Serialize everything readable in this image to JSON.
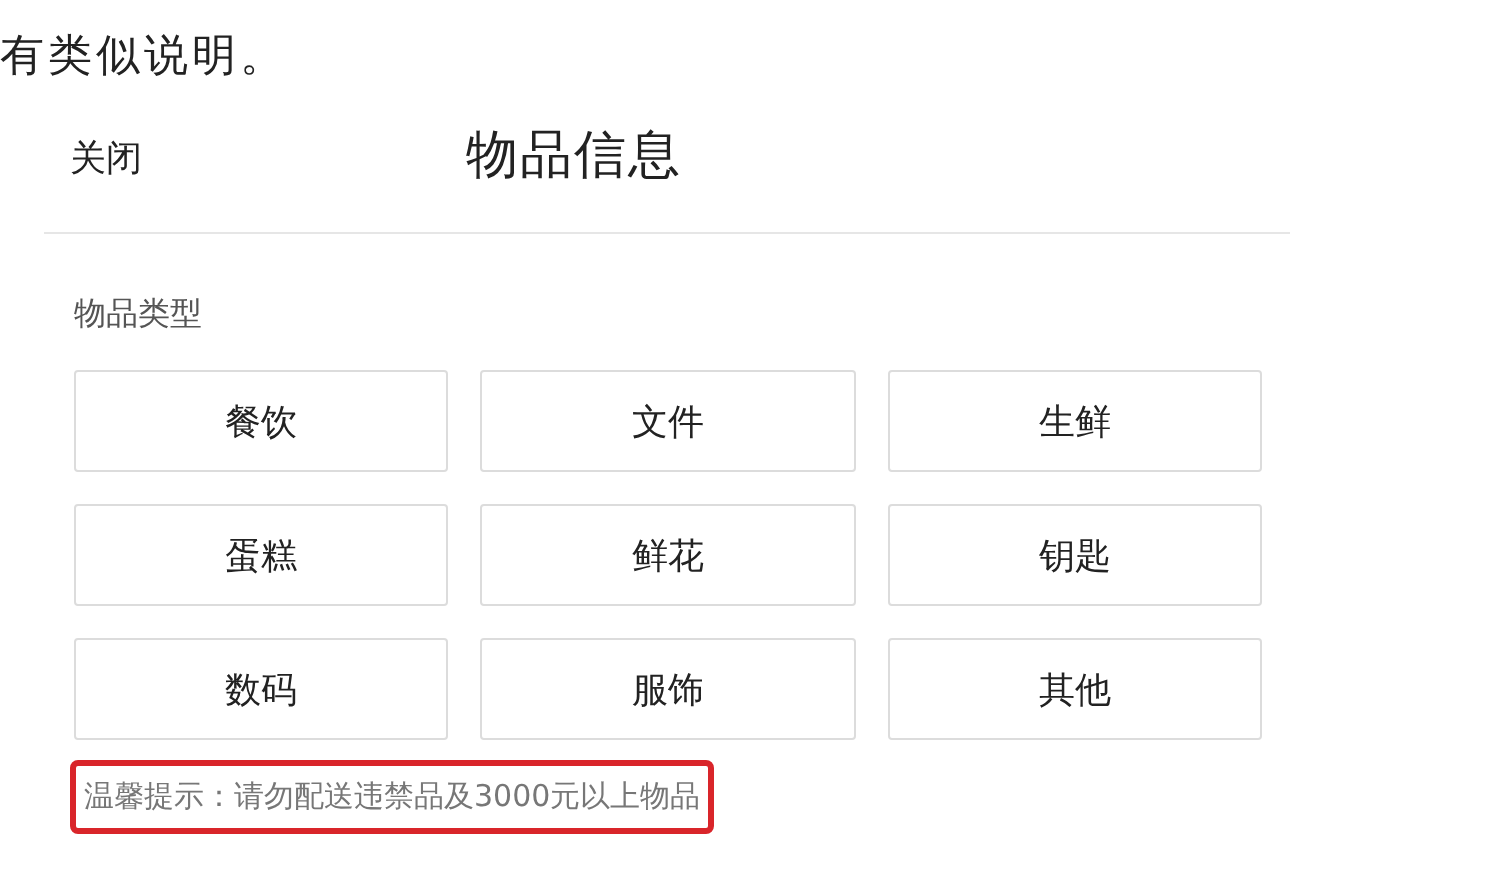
{
  "article_text": "有类似说明。",
  "header": {
    "close": "关闭",
    "title": "物品信息"
  },
  "section_label": "物品类型",
  "categories": [
    {
      "label": "餐饮"
    },
    {
      "label": "文件"
    },
    {
      "label": "生鲜"
    },
    {
      "label": "蛋糕"
    },
    {
      "label": "鲜花"
    },
    {
      "label": "钥匙"
    },
    {
      "label": "数码"
    },
    {
      "label": "服饰"
    },
    {
      "label": "其他"
    }
  ],
  "hint": {
    "text": "温馨提示：请勿配送违禁品及3000元以上物品",
    "highlighted": true
  }
}
